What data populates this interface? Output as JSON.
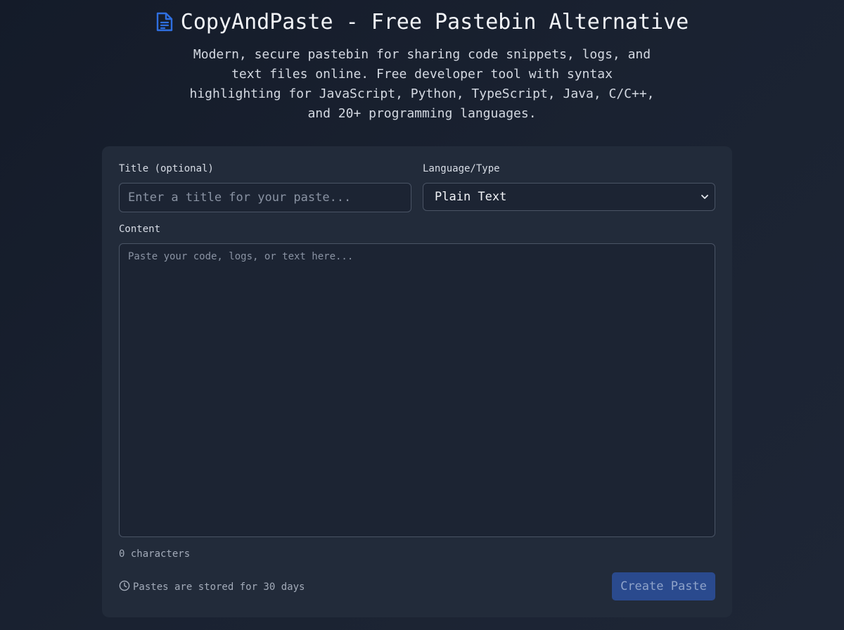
{
  "header": {
    "icon": "document-icon",
    "title": "CopyAndPaste - Free Pastebin Alternative",
    "subtitle": "Modern, secure pastebin for sharing code snippets, logs, and text files online. Free developer tool with syntax highlighting for JavaScript, Python, TypeScript, Java, C/C++, and 20+ programming languages."
  },
  "form": {
    "title_label": "Title (optional)",
    "title_placeholder": "Enter a title for your paste...",
    "title_value": "",
    "language_label": "Language/Type",
    "language_selected": "Plain Text",
    "content_label": "Content",
    "content_placeholder": "Paste your code, logs, or text here...",
    "content_value": "",
    "char_count": "0 characters",
    "retention_icon": "clock-icon",
    "retention_text": "Pastes are stored for 30 days",
    "create_label": "Create Paste"
  },
  "colors": {
    "accent": "#2f6fe0",
    "button_bg": "#2a4a8e",
    "card_bg": "#222b3a",
    "page_bg": "#171e2b"
  }
}
